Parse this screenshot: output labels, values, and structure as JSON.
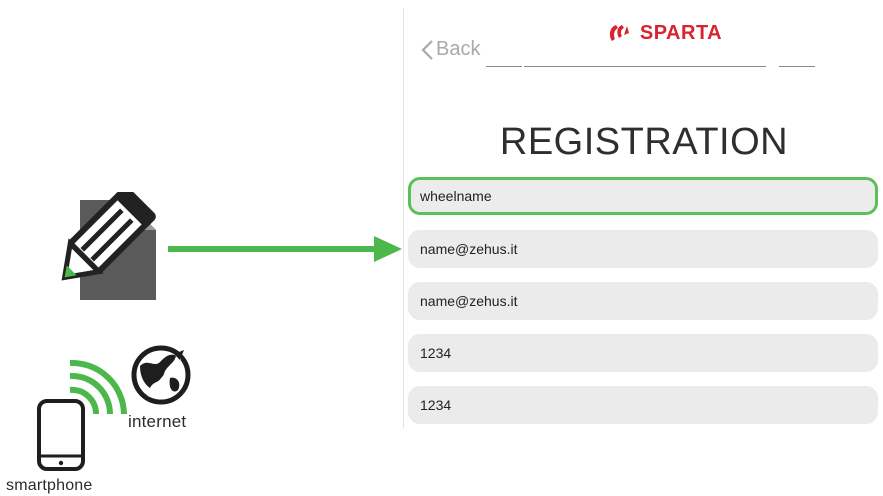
{
  "labels": {
    "internet": "internet",
    "smartphone": "smartphone"
  },
  "icons": {
    "document": "edit-document-icon",
    "arrow": "right-arrow-icon",
    "wifi": "wifi-signal-icon",
    "globe": "globe-icon",
    "phone": "smartphone-icon"
  },
  "screen": {
    "back_label": "Back",
    "brand": "SPARTA",
    "title": "REGISTRATION",
    "fields": [
      {
        "value": "wheelname"
      },
      {
        "value": "name@zehus.it"
      },
      {
        "value": "name@zehus.it"
      },
      {
        "value": "1234"
      },
      {
        "value": "1234"
      }
    ]
  },
  "colors": {
    "accent_green": "#4cb84c",
    "brand_red": "#d9232e",
    "icon_gray": "#5a5a5a"
  }
}
